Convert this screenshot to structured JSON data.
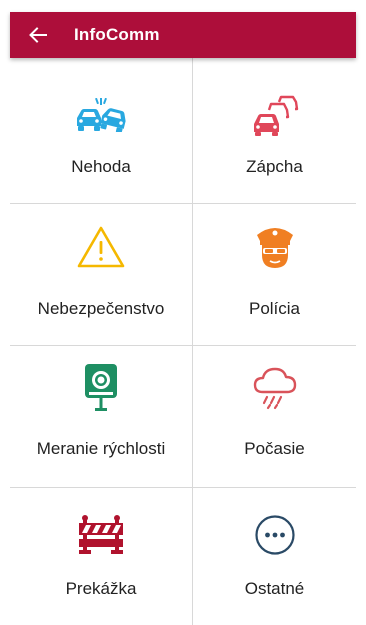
{
  "app_bar": {
    "title": "InfoComm",
    "back_icon": "back-arrow-icon",
    "color": "#ad0e3a"
  },
  "categories": [
    {
      "label": "Nehoda",
      "icon": "car-crash-icon",
      "color": "#29a8e0"
    },
    {
      "label": "Zápcha",
      "icon": "traffic-jam-icon",
      "color": "#e0475a"
    },
    {
      "label": "Nebezpečenstvo",
      "icon": "warning-icon",
      "color": "#f5b800"
    },
    {
      "label": "Polícia",
      "icon": "police-icon",
      "color": "#f07f22"
    },
    {
      "label": "Meranie rýchlosti",
      "icon": "speed-camera-icon",
      "color": "#1e8f63"
    },
    {
      "label": "Počasie",
      "icon": "weather-icon",
      "color": "#d9535a"
    },
    {
      "label": "Prekážka",
      "icon": "roadblock-icon",
      "color": "#b0122d"
    },
    {
      "label": "Ostatné",
      "icon": "more-icon",
      "color": "#2a4a66"
    }
  ]
}
